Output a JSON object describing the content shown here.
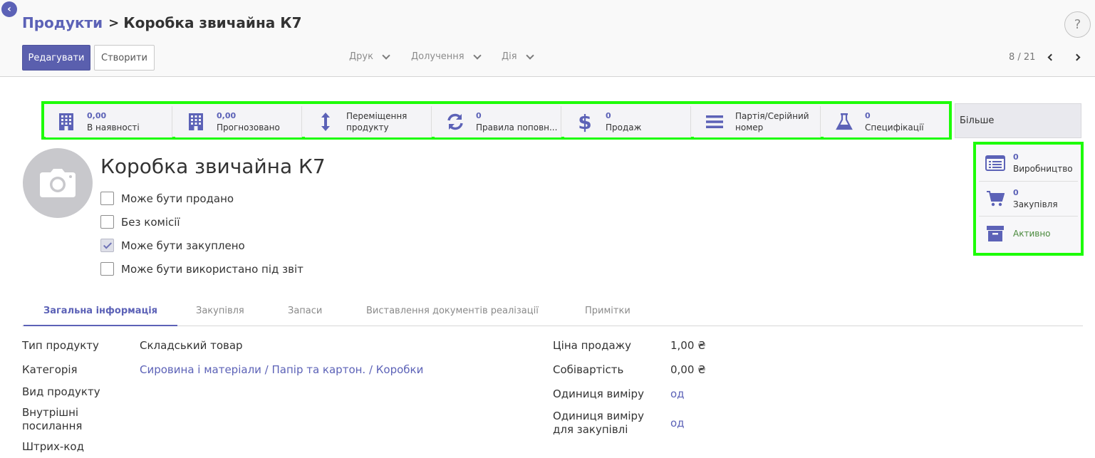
{
  "breadcrumb": {
    "parent": "Продукти",
    "separator": ">",
    "current": "Коробка звичайна К7"
  },
  "help_label": "?",
  "actions": {
    "edit_label": "Редагувати",
    "create_label": "Створити",
    "print_label": "Друк",
    "attachment_label": "Долучення",
    "action_label": "Дія"
  },
  "pager": {
    "text": "8 / 21"
  },
  "smart_buttons": [
    {
      "value": "0,00",
      "label": "В наявності",
      "icon": "building-icon"
    },
    {
      "value": "0,00",
      "label": "Прогнозовано",
      "icon": "building-icon"
    },
    {
      "value": "",
      "label": "Переміщення",
      "label2": "продукту",
      "icon": "vertical-arrows-icon"
    },
    {
      "value": "0",
      "label": "Правила поповн...",
      "icon": "refresh-icon"
    },
    {
      "value": "0",
      "label": "Продаж",
      "icon": "dollar-icon"
    },
    {
      "value": "",
      "label": "Партія/Серійний",
      "label2": "номер",
      "icon": "bars-icon"
    },
    {
      "value": "0",
      "label": "Специфікації",
      "icon": "flask-icon"
    }
  ],
  "more_label": "Більше",
  "more_menu": [
    {
      "value": "0",
      "label": "Виробництво",
      "icon": "list-alt-icon"
    },
    {
      "value": "0",
      "label": "Закупівля",
      "icon": "cart-icon"
    },
    {
      "value": "",
      "label": "Активно",
      "icon": "archive-icon"
    }
  ],
  "product": {
    "name": "Коробка звичайна К7",
    "checkboxes": [
      {
        "label": "Може бути продано",
        "checked": false
      },
      {
        "label": "Без комісії",
        "checked": false
      },
      {
        "label": "Може бути закуплено",
        "checked": true
      },
      {
        "label": "Може бути використано під звіт",
        "checked": false
      }
    ]
  },
  "tabs": [
    {
      "label": "Загальна інформація",
      "active": true
    },
    {
      "label": "Закупівля",
      "active": false
    },
    {
      "label": "Запаси",
      "active": false
    },
    {
      "label": "Виставлення документів реалізації",
      "active": false
    },
    {
      "label": "Примітки",
      "active": false
    }
  ],
  "general_info": {
    "left": {
      "product_type_label": "Тип продукту",
      "product_type_value": "Складський товар",
      "category_label": "Категорія",
      "category_value": "Сировина і матеріали / Папір та картон. / Коробки",
      "kind_label": "Вид продукту",
      "internal_ref_label_1": "Внутрішні",
      "internal_ref_label_2": "посилання",
      "barcode_label": "Штрих-код"
    },
    "right": {
      "sale_price_label": "Ціна продажу",
      "sale_price_value": "1,00 ₴",
      "cost_label": "Собівартість",
      "cost_value": "0,00 ₴",
      "uom_label": "Одиниця виміру",
      "uom_value": "од",
      "purchase_uom_label_1": "Одиниця виміру",
      "purchase_uom_label_2": "для закупівлі",
      "purchase_uom_value": "од"
    }
  },
  "colors": {
    "accent": "#5c62b7",
    "highlight": "#1dfc08",
    "active_green": "#4a8a3c"
  }
}
